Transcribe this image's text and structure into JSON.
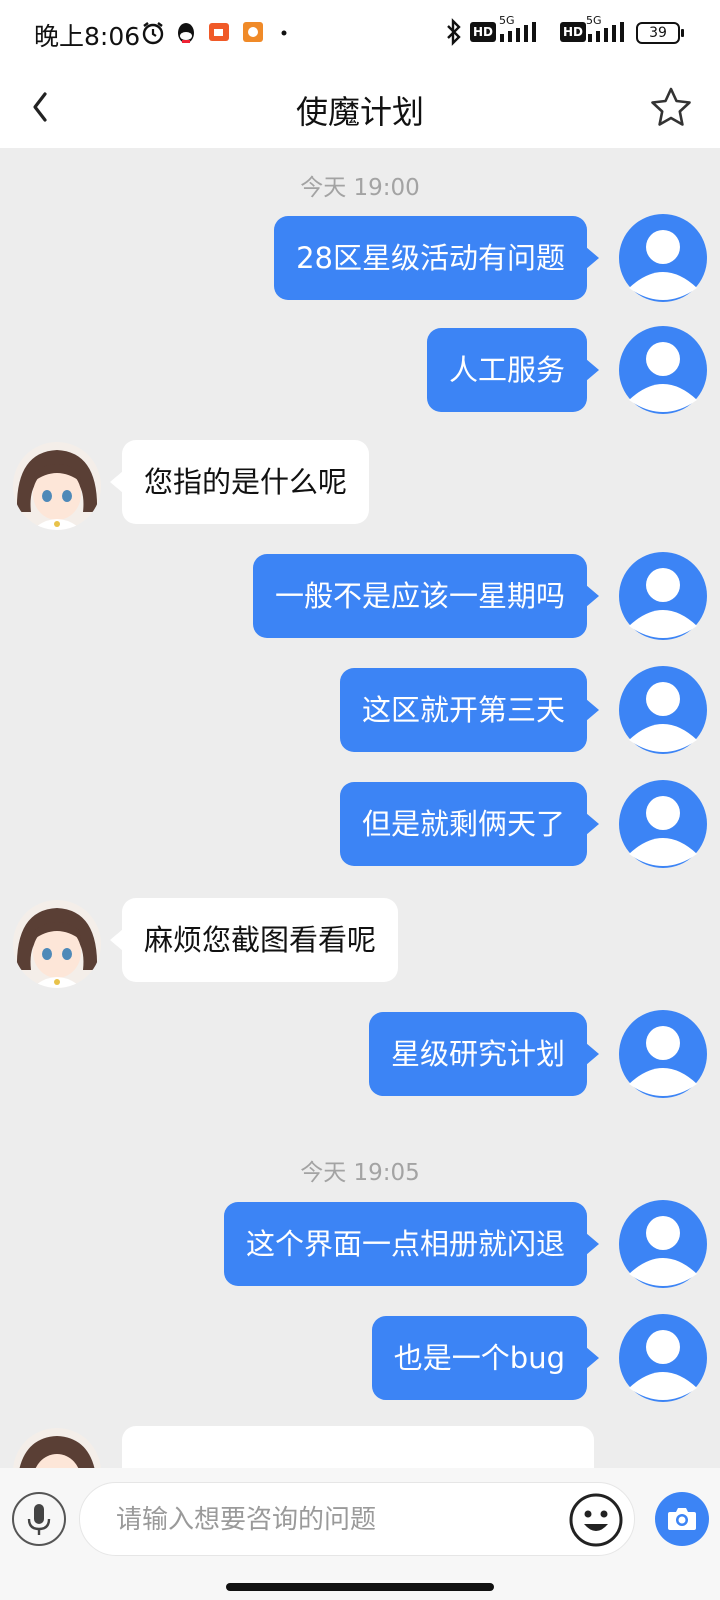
{
  "status_bar": {
    "time": "晚上8:06",
    "battery": "39",
    "network_1": "5G",
    "network_2": "5G",
    "hd_1": "HD",
    "hd_2": "HD"
  },
  "header": {
    "title": "使魔计划"
  },
  "chat": {
    "timestamps": [
      "今天 19:00",
      "今天 19:05"
    ],
    "messages": [
      {
        "from": "me",
        "text": "28区星级活动有问题"
      },
      {
        "from": "me",
        "text": "人工服务"
      },
      {
        "from": "other",
        "text": "您指的是什么呢"
      },
      {
        "from": "me",
        "text": "一般不是应该一星期吗"
      },
      {
        "from": "me",
        "text": "这区就开第三天"
      },
      {
        "from": "me",
        "text": "但是就剩俩天了"
      },
      {
        "from": "other",
        "text": "麻烦您截图看看呢"
      },
      {
        "from": "me",
        "text": "星级研究计划"
      },
      {
        "from": "me",
        "text": "这个界面一点相册就闪退"
      },
      {
        "from": "me",
        "text": "也是一个bug"
      }
    ]
  },
  "input_bar": {
    "placeholder": "请输入想要咨询的问题"
  },
  "icons": {
    "back": "chevron-left-icon",
    "favorite": "star-icon",
    "voice": "microphone-icon",
    "emoji": "emoji-icon",
    "camera": "camera-icon"
  },
  "colors": {
    "accent": "#3c84f5",
    "chat_background": "#ededed",
    "incoming_bubble": "#ffffff"
  }
}
